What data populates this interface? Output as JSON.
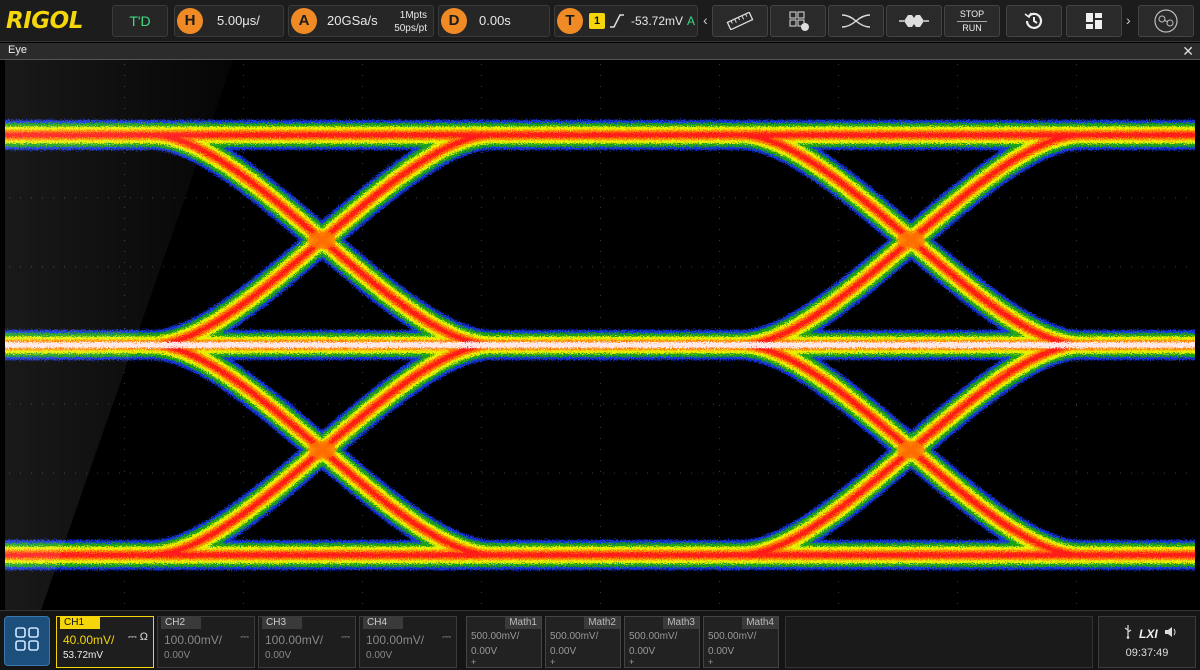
{
  "brand": "RIGOL",
  "topbar": {
    "run_state": "T'D",
    "horizontal": {
      "icon_label": "H",
      "timebase": "5.00μs/"
    },
    "acquire": {
      "icon_label": "A",
      "sample_rate": "20GSa/s",
      "memory_depth": "1Mpts",
      "points": "50ps/pt"
    },
    "delay": {
      "icon_label": "D",
      "value": "0.00s"
    },
    "trigger": {
      "icon_label": "T",
      "source": "1",
      "level": "-53.72mV",
      "mode": "A"
    },
    "tools": [
      {
        "name": "measure-ruler-icon"
      },
      {
        "name": "function-menu-icon"
      },
      {
        "name": "eye-diagram-icon"
      },
      {
        "name": "jitter-icon"
      },
      {
        "name": "stop-run"
      },
      {
        "name": "history-icon"
      },
      {
        "name": "app-grid-icon"
      },
      {
        "name": "network-icon"
      }
    ],
    "stop_label": "STOP",
    "run_label": "RUN"
  },
  "eye_window": {
    "title": "Eye",
    "close": "✕"
  },
  "colors": {
    "ch1": "#f5d60a",
    "trigger": "#f08a24",
    "running": "#3ddc84",
    "persistence": [
      "#1a3cff",
      "#1ea11e",
      "#e8f000",
      "#ff7a00",
      "#ff1a1a",
      "#ffffff"
    ]
  },
  "channels": [
    {
      "label": "CH1",
      "scale": "40.00mV/",
      "offset": "53.72mV",
      "coupling": "⎓ Ω",
      "active": true
    },
    {
      "label": "CH2",
      "scale": "100.00mV/",
      "offset": "0.00V",
      "coupling": "⎓",
      "active": false
    },
    {
      "label": "CH3",
      "scale": "100.00mV/",
      "offset": "0.00V",
      "coupling": "⎓",
      "active": false
    },
    {
      "label": "CH4",
      "scale": "100.00mV/",
      "offset": "0.00V",
      "coupling": "⎓",
      "active": false
    }
  ],
  "math": [
    {
      "label": "Math1",
      "scale": "500.00mV/",
      "offset": "0.00V",
      "plus": "+"
    },
    {
      "label": "Math2",
      "scale": "500.00mV/",
      "offset": "0.00V",
      "plus": "+"
    },
    {
      "label": "Math3",
      "scale": "500.00mV/",
      "offset": "0.00V",
      "plus": "+"
    },
    {
      "label": "Math4",
      "scale": "500.00mV/",
      "offset": "0.00V",
      "plus": "+"
    }
  ],
  "status": {
    "usb_icon": "usb-icon",
    "lxi": "LXI",
    "speaker_icon": "speaker-icon",
    "time": "09:37:49"
  }
}
